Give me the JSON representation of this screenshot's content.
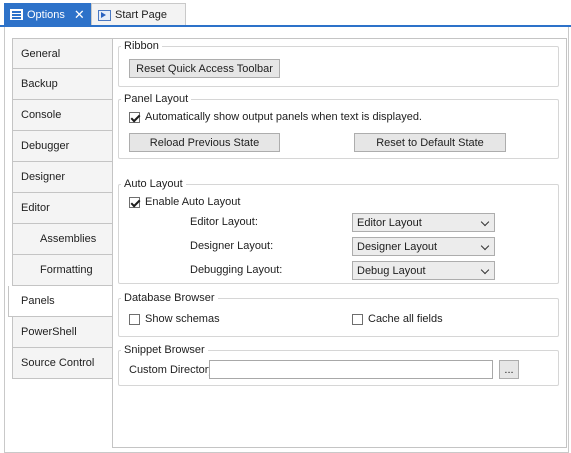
{
  "tabs": {
    "active": {
      "label": "Options",
      "icon": "options-icon"
    },
    "inactive": {
      "label": "Start Page",
      "icon": "start-page-icon"
    },
    "close_glyph": "✕"
  },
  "categories": [
    {
      "label": "General"
    },
    {
      "label": "Backup"
    },
    {
      "label": "Console"
    },
    {
      "label": "Debugger"
    },
    {
      "label": "Designer"
    },
    {
      "label": "Editor"
    },
    {
      "label": "Assemblies"
    },
    {
      "label": "Formatting"
    },
    {
      "label": "Panels"
    },
    {
      "label": "PowerShell"
    },
    {
      "label": "Source Control"
    }
  ],
  "ribbon": {
    "legend": "Ribbon",
    "reset_button": "Reset Quick Access Toolbar"
  },
  "panel_layout": {
    "legend": "Panel Layout",
    "auto_show_label": "Automatically show output panels when text is displayed.",
    "auto_show_checked": true,
    "reload_button": "Reload Previous State",
    "reset_default_button": "Reset to Default State"
  },
  "auto_layout": {
    "legend": "Auto Layout",
    "enable_label": "Enable Auto Layout",
    "enable_checked": true,
    "editor_label": "Editor Layout:",
    "editor_value": "Editor Layout",
    "designer_label": "Designer Layout:",
    "designer_value": "Designer Layout",
    "debugging_label": "Debugging Layout:",
    "debugging_value": "Debug Layout"
  },
  "database_browser": {
    "legend": "Database Browser",
    "show_schemas_label": "Show schemas",
    "show_schemas_checked": false,
    "cache_fields_label": "Cache all fields",
    "cache_fields_checked": false
  },
  "snippet_browser": {
    "legend": "Snippet Browser",
    "custom_dir_label": "Custom Directory:",
    "custom_dir_value": "",
    "browse_button": "..."
  },
  "colors": {
    "accent": "#2d72c9",
    "border": "#c4c4c4",
    "button_bg": "#e6e6e6"
  }
}
